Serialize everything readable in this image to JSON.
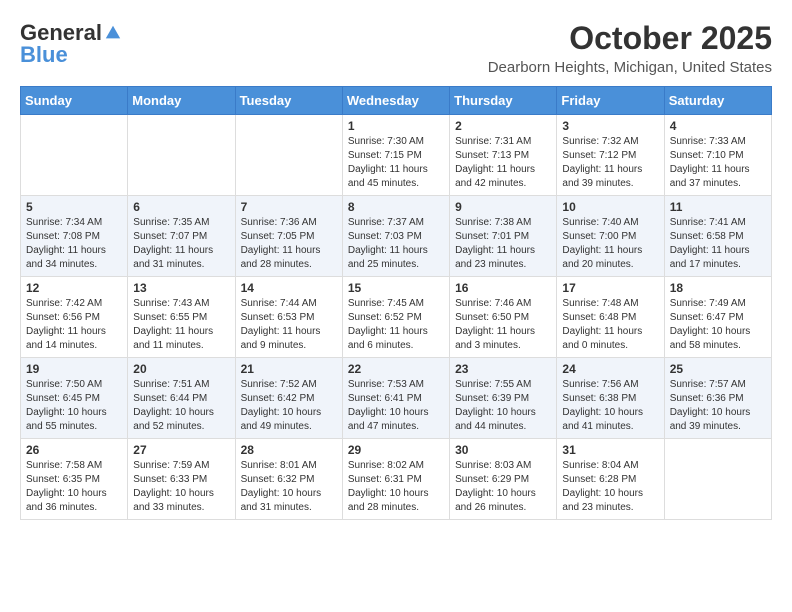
{
  "header": {
    "logo_general": "General",
    "logo_blue": "Blue",
    "month_title": "October 2025",
    "location": "Dearborn Heights, Michigan, United States"
  },
  "days_of_week": [
    "Sunday",
    "Monday",
    "Tuesday",
    "Wednesday",
    "Thursday",
    "Friday",
    "Saturday"
  ],
  "weeks": [
    [
      {
        "day": "",
        "sunrise": "",
        "sunset": "",
        "daylight": ""
      },
      {
        "day": "",
        "sunrise": "",
        "sunset": "",
        "daylight": ""
      },
      {
        "day": "",
        "sunrise": "",
        "sunset": "",
        "daylight": ""
      },
      {
        "day": "1",
        "sunrise": "Sunrise: 7:30 AM",
        "sunset": "Sunset: 7:15 PM",
        "daylight": "Daylight: 11 hours and 45 minutes."
      },
      {
        "day": "2",
        "sunrise": "Sunrise: 7:31 AM",
        "sunset": "Sunset: 7:13 PM",
        "daylight": "Daylight: 11 hours and 42 minutes."
      },
      {
        "day": "3",
        "sunrise": "Sunrise: 7:32 AM",
        "sunset": "Sunset: 7:12 PM",
        "daylight": "Daylight: 11 hours and 39 minutes."
      },
      {
        "day": "4",
        "sunrise": "Sunrise: 7:33 AM",
        "sunset": "Sunset: 7:10 PM",
        "daylight": "Daylight: 11 hours and 37 minutes."
      }
    ],
    [
      {
        "day": "5",
        "sunrise": "Sunrise: 7:34 AM",
        "sunset": "Sunset: 7:08 PM",
        "daylight": "Daylight: 11 hours and 34 minutes."
      },
      {
        "day": "6",
        "sunrise": "Sunrise: 7:35 AM",
        "sunset": "Sunset: 7:07 PM",
        "daylight": "Daylight: 11 hours and 31 minutes."
      },
      {
        "day": "7",
        "sunrise": "Sunrise: 7:36 AM",
        "sunset": "Sunset: 7:05 PM",
        "daylight": "Daylight: 11 hours and 28 minutes."
      },
      {
        "day": "8",
        "sunrise": "Sunrise: 7:37 AM",
        "sunset": "Sunset: 7:03 PM",
        "daylight": "Daylight: 11 hours and 25 minutes."
      },
      {
        "day": "9",
        "sunrise": "Sunrise: 7:38 AM",
        "sunset": "Sunset: 7:01 PM",
        "daylight": "Daylight: 11 hours and 23 minutes."
      },
      {
        "day": "10",
        "sunrise": "Sunrise: 7:40 AM",
        "sunset": "Sunset: 7:00 PM",
        "daylight": "Daylight: 11 hours and 20 minutes."
      },
      {
        "day": "11",
        "sunrise": "Sunrise: 7:41 AM",
        "sunset": "Sunset: 6:58 PM",
        "daylight": "Daylight: 11 hours and 17 minutes."
      }
    ],
    [
      {
        "day": "12",
        "sunrise": "Sunrise: 7:42 AM",
        "sunset": "Sunset: 6:56 PM",
        "daylight": "Daylight: 11 hours and 14 minutes."
      },
      {
        "day": "13",
        "sunrise": "Sunrise: 7:43 AM",
        "sunset": "Sunset: 6:55 PM",
        "daylight": "Daylight: 11 hours and 11 minutes."
      },
      {
        "day": "14",
        "sunrise": "Sunrise: 7:44 AM",
        "sunset": "Sunset: 6:53 PM",
        "daylight": "Daylight: 11 hours and 9 minutes."
      },
      {
        "day": "15",
        "sunrise": "Sunrise: 7:45 AM",
        "sunset": "Sunset: 6:52 PM",
        "daylight": "Daylight: 11 hours and 6 minutes."
      },
      {
        "day": "16",
        "sunrise": "Sunrise: 7:46 AM",
        "sunset": "Sunset: 6:50 PM",
        "daylight": "Daylight: 11 hours and 3 minutes."
      },
      {
        "day": "17",
        "sunrise": "Sunrise: 7:48 AM",
        "sunset": "Sunset: 6:48 PM",
        "daylight": "Daylight: 11 hours and 0 minutes."
      },
      {
        "day": "18",
        "sunrise": "Sunrise: 7:49 AM",
        "sunset": "Sunset: 6:47 PM",
        "daylight": "Daylight: 10 hours and 58 minutes."
      }
    ],
    [
      {
        "day": "19",
        "sunrise": "Sunrise: 7:50 AM",
        "sunset": "Sunset: 6:45 PM",
        "daylight": "Daylight: 10 hours and 55 minutes."
      },
      {
        "day": "20",
        "sunrise": "Sunrise: 7:51 AM",
        "sunset": "Sunset: 6:44 PM",
        "daylight": "Daylight: 10 hours and 52 minutes."
      },
      {
        "day": "21",
        "sunrise": "Sunrise: 7:52 AM",
        "sunset": "Sunset: 6:42 PM",
        "daylight": "Daylight: 10 hours and 49 minutes."
      },
      {
        "day": "22",
        "sunrise": "Sunrise: 7:53 AM",
        "sunset": "Sunset: 6:41 PM",
        "daylight": "Daylight: 10 hours and 47 minutes."
      },
      {
        "day": "23",
        "sunrise": "Sunrise: 7:55 AM",
        "sunset": "Sunset: 6:39 PM",
        "daylight": "Daylight: 10 hours and 44 minutes."
      },
      {
        "day": "24",
        "sunrise": "Sunrise: 7:56 AM",
        "sunset": "Sunset: 6:38 PM",
        "daylight": "Daylight: 10 hours and 41 minutes."
      },
      {
        "day": "25",
        "sunrise": "Sunrise: 7:57 AM",
        "sunset": "Sunset: 6:36 PM",
        "daylight": "Daylight: 10 hours and 39 minutes."
      }
    ],
    [
      {
        "day": "26",
        "sunrise": "Sunrise: 7:58 AM",
        "sunset": "Sunset: 6:35 PM",
        "daylight": "Daylight: 10 hours and 36 minutes."
      },
      {
        "day": "27",
        "sunrise": "Sunrise: 7:59 AM",
        "sunset": "Sunset: 6:33 PM",
        "daylight": "Daylight: 10 hours and 33 minutes."
      },
      {
        "day": "28",
        "sunrise": "Sunrise: 8:01 AM",
        "sunset": "Sunset: 6:32 PM",
        "daylight": "Daylight: 10 hours and 31 minutes."
      },
      {
        "day": "29",
        "sunrise": "Sunrise: 8:02 AM",
        "sunset": "Sunset: 6:31 PM",
        "daylight": "Daylight: 10 hours and 28 minutes."
      },
      {
        "day": "30",
        "sunrise": "Sunrise: 8:03 AM",
        "sunset": "Sunset: 6:29 PM",
        "daylight": "Daylight: 10 hours and 26 minutes."
      },
      {
        "day": "31",
        "sunrise": "Sunrise: 8:04 AM",
        "sunset": "Sunset: 6:28 PM",
        "daylight": "Daylight: 10 hours and 23 minutes."
      },
      {
        "day": "",
        "sunrise": "",
        "sunset": "",
        "daylight": ""
      }
    ]
  ]
}
